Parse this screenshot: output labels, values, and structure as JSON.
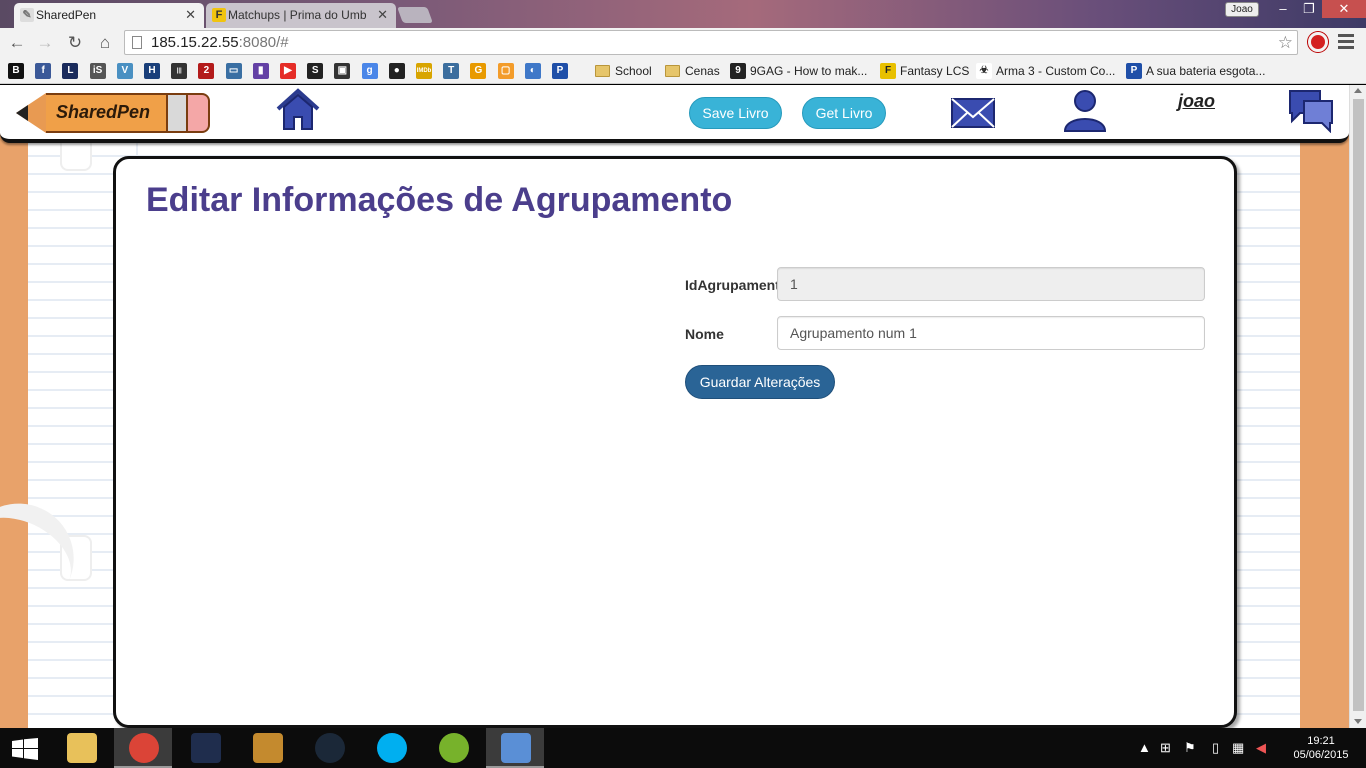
{
  "browser": {
    "tabs": [
      {
        "title": "SharedPen",
        "active": true
      },
      {
        "title": "Matchups | Prima do Umb",
        "active": false
      }
    ],
    "profile_name": "Joao",
    "window_controls": {
      "minimize": "–",
      "maximize": "❐",
      "close": "✕"
    },
    "tab_close": "✕",
    "address": {
      "host": "185.15.22.55",
      "rest": ":8080/#"
    },
    "bookmarks": [
      {
        "label": "School",
        "type": "folder"
      },
      {
        "label": "Cenas",
        "type": "folder"
      },
      {
        "label": "9GAG - How to mak...",
        "type": "site",
        "color": "#222222",
        "icon": "9"
      },
      {
        "label": "Fantasy LCS",
        "type": "site",
        "color": "#e8c000",
        "icon": "F"
      },
      {
        "label": "Arma 3 - Custom Co...",
        "type": "site",
        "color": "#333333",
        "icon": "☣"
      },
      {
        "label": "A sua bateria esgota...",
        "type": "site",
        "color": "#1f4fa8",
        "icon": "P"
      }
    ],
    "bookmark_icons": [
      {
        "icon": "B",
        "color": "#111111"
      },
      {
        "icon": "f",
        "color": "#3b5998"
      },
      {
        "icon": "L",
        "color": "#1a2b5c"
      },
      {
        "icon": "iS",
        "color": "#555555"
      },
      {
        "icon": "V",
        "color": "#4a90c2"
      },
      {
        "icon": "H",
        "color": "#1a3f7a"
      },
      {
        "icon": "|||",
        "color": "#333333"
      },
      {
        "icon": "2",
        "color": "#b31b1b"
      },
      {
        "icon": "▭",
        "color": "#3a6fa3"
      },
      {
        "icon": "▮",
        "color": "#6441a5"
      },
      {
        "icon": "▶",
        "color": "#e52d27"
      },
      {
        "icon": "S",
        "color": "#222222"
      },
      {
        "icon": "▣",
        "color": "#333333"
      },
      {
        "icon": "g",
        "color": "#4a86e8"
      },
      {
        "icon": "●",
        "color": "#222222"
      },
      {
        "icon": "IMDb",
        "color": "#d8a500"
      },
      {
        "icon": "T",
        "color": "#3c6e9e"
      },
      {
        "icon": "G",
        "color": "#e89a00"
      },
      {
        "icon": "▢",
        "color": "#f39c2a"
      },
      {
        "icon": "◐",
        "color": "#3f78c8"
      },
      {
        "icon": "P",
        "color": "#1f4fa8"
      }
    ]
  },
  "app": {
    "logo": "SharedPen",
    "header": {
      "save_livro": "Save Livro",
      "get_livro": "Get Livro",
      "username": "joao"
    },
    "page_title": "Editar Informações de Agrupamento",
    "form": {
      "id_label": "IdAgrupamento",
      "id_value": "1",
      "nome_label": "Nome",
      "nome_value": "Agrupamento num 1",
      "submit": "Guardar Alterações"
    }
  },
  "taskbar": {
    "time": "19:21",
    "date": "05/06/2015",
    "apps": [
      {
        "name": "file-explorer",
        "color": "#e8c15a",
        "open": false
      },
      {
        "name": "chrome",
        "color": "#db4437",
        "open": true
      },
      {
        "name": "league-of-legends",
        "color": "#1f2d4d",
        "open": false
      },
      {
        "name": "hearthstone",
        "color": "#c48a2e",
        "open": false
      },
      {
        "name": "steam",
        "color": "#1b2838",
        "open": false
      },
      {
        "name": "skype",
        "color": "#00aff0",
        "open": false
      },
      {
        "name": "utorrent",
        "color": "#77b22b",
        "open": false
      },
      {
        "name": "paint",
        "color": "#5a8fd6",
        "open": true
      }
    ]
  }
}
